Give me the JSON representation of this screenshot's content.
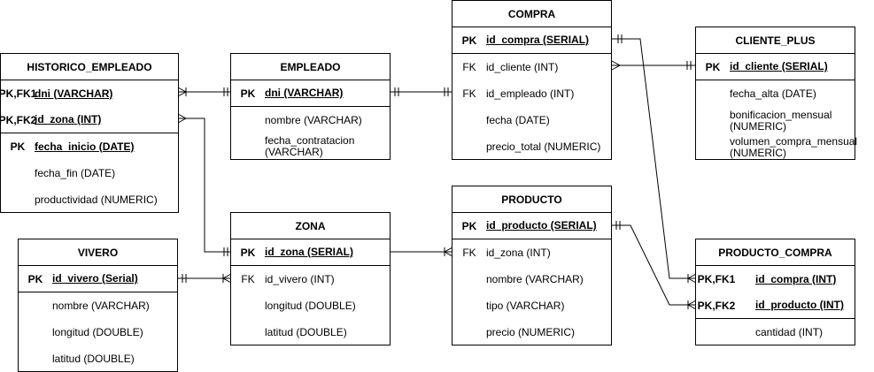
{
  "entities": {
    "historico_empleado": {
      "title": "HISTORICO_EMPLEADO",
      "rows": [
        {
          "key": "PK,FK1",
          "field": "dni (VARCHAR)"
        },
        {
          "key": "PK,FK2",
          "field": "id_zona (INT)"
        },
        {
          "key": "PK",
          "field": "fecha_inicio (DATE)"
        },
        {
          "key": "",
          "field": "fecha_fin (DATE)"
        },
        {
          "key": "",
          "field": "productividad (NUMERIC)"
        }
      ]
    },
    "empleado": {
      "title": "EMPLEADO",
      "rows": [
        {
          "key": "PK",
          "field": "dni (VARCHAR)"
        },
        {
          "key": "",
          "field": "nombre (VARCHAR)"
        },
        {
          "key": "",
          "field": "fecha_contratacion (VARCHAR)"
        }
      ]
    },
    "compra": {
      "title": "COMPRA",
      "rows": [
        {
          "key": "PK",
          "field": "id_compra (SERIAL)"
        },
        {
          "key": "FK",
          "field": "id_cliente (INT)"
        },
        {
          "key": "FK",
          "field": "id_empleado (INT)"
        },
        {
          "key": "",
          "field": "fecha (DATE)"
        },
        {
          "key": "",
          "field": "precio_total (NUMERIC)"
        }
      ]
    },
    "cliente_plus": {
      "title": "CLIENTE_PLUS",
      "rows": [
        {
          "key": "PK",
          "field": "id_cliente (SERIAL)"
        },
        {
          "key": "",
          "field": "fecha_alta (DATE)"
        },
        {
          "key": "",
          "field": "bonificacion_mensual (NUMERIC)"
        },
        {
          "key": "",
          "field": "volumen_compra_mensual (NUMERIC)"
        }
      ]
    },
    "zona": {
      "title": "ZONA",
      "rows": [
        {
          "key": "PK",
          "field": "id_zona (SERIAL)"
        },
        {
          "key": "FK",
          "field": "id_vivero (INT)"
        },
        {
          "key": "",
          "field": "longitud (DOUBLE)"
        },
        {
          "key": "",
          "field": "latitud (DOUBLE)"
        }
      ]
    },
    "producto": {
      "title": "PRODUCTO",
      "rows": [
        {
          "key": "PK",
          "field": "id_producto (SERIAL)"
        },
        {
          "key": "FK",
          "field": "id_zona (INT)"
        },
        {
          "key": "",
          "field": "nombre (VARCHAR)"
        },
        {
          "key": "",
          "field": "tipo (VARCHAR)"
        },
        {
          "key": "",
          "field": "precio (NUMERIC)"
        }
      ]
    },
    "vivero": {
      "title": "VIVERO",
      "rows": [
        {
          "key": "PK",
          "field": "id_vivero (Serial)"
        },
        {
          "key": "",
          "field": "nombre (VARCHAR)"
        },
        {
          "key": "",
          "field": "longitud (DOUBLE)"
        },
        {
          "key": "",
          "field": "latitud (DOUBLE)"
        }
      ]
    },
    "producto_compra": {
      "title": "PRODUCTO_COMPRA",
      "rows": [
        {
          "key": "PK,FK1",
          "field": "id_compra (INT)"
        },
        {
          "key": "PK,FK2",
          "field": "id_producto (INT)"
        },
        {
          "key": "",
          "field": "cantidad (INT)"
        }
      ]
    }
  }
}
